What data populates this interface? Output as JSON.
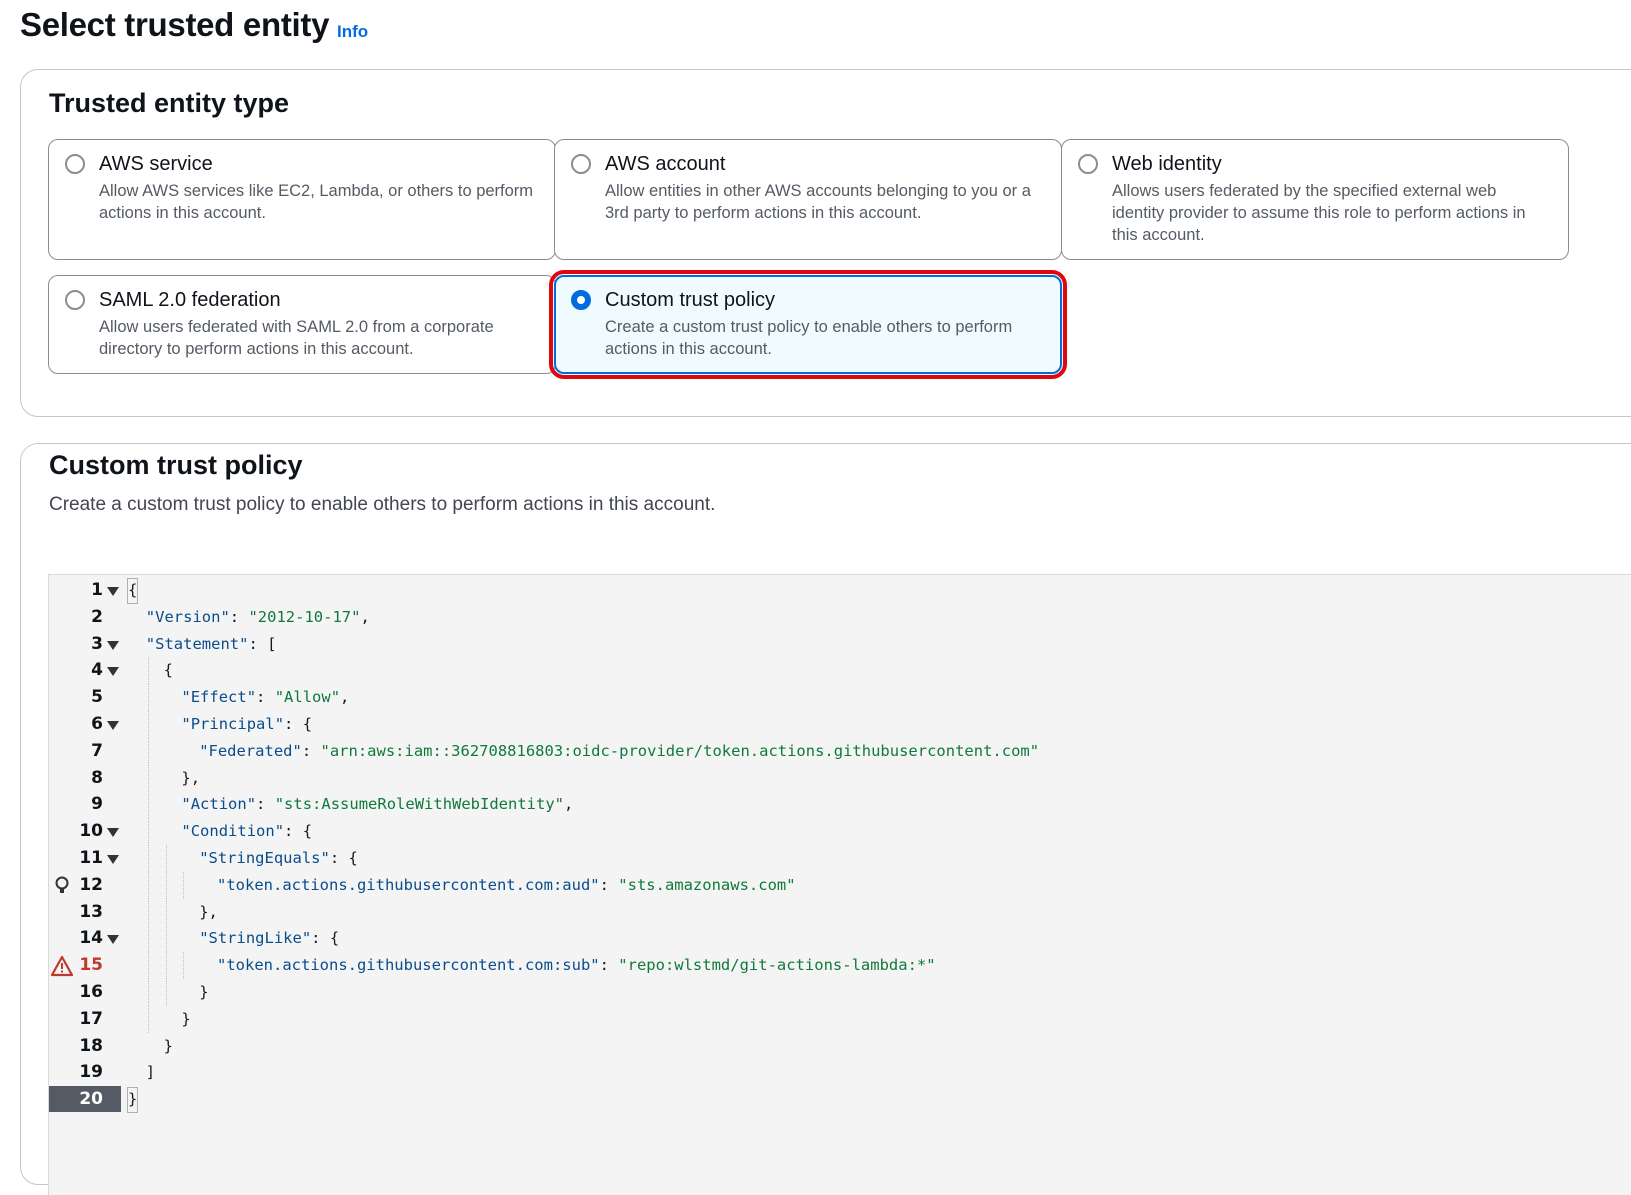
{
  "header": {
    "title": "Select trusted entity",
    "info_link": "Info"
  },
  "entity_section": {
    "heading": "Trusted entity type",
    "options": [
      {
        "title": "AWS service",
        "description": "Allow AWS services like EC2, Lambda, or others to perform actions in this account.",
        "selected": false
      },
      {
        "title": "AWS account",
        "description": "Allow entities in other AWS accounts belonging to you or a 3rd party to perform actions in this account.",
        "selected": false
      },
      {
        "title": "Web identity",
        "description": "Allows users federated by the specified external web identity provider to assume this role to perform actions in this account.",
        "selected": false
      },
      {
        "title": "SAML 2.0 federation",
        "description": "Allow users federated with SAML 2.0 from a corporate directory to perform actions in this account.",
        "selected": false
      },
      {
        "title": "Custom trust policy",
        "description": "Create a custom trust policy to enable others to perform actions in this account.",
        "selected": true
      }
    ]
  },
  "policy_section": {
    "heading": "Custom trust policy",
    "description": "Create a custom trust policy to enable others to perform actions in this account.",
    "editor": {
      "active_line": 20,
      "lines": [
        {
          "n": "1",
          "text": "{"
        },
        {
          "n": "2",
          "text": "\"Version\": \"2012-10-17\","
        },
        {
          "n": "3",
          "text": "\"Statement\": ["
        },
        {
          "n": "4",
          "text": "{"
        },
        {
          "n": "5",
          "text": "\"Effect\": \"Allow\","
        },
        {
          "n": "6",
          "text": "\"Principal\": {"
        },
        {
          "n": "7",
          "text": "\"Federated\": \"arn:aws:iam::362708816803:oidc-provider/token.actions.githubusercontent.com\""
        },
        {
          "n": "8",
          "text": "},"
        },
        {
          "n": "9",
          "text": "\"Action\": \"sts:AssumeRoleWithWebIdentity\","
        },
        {
          "n": "10",
          "text": "\"Condition\": {"
        },
        {
          "n": "11",
          "text": "\"StringEquals\": {"
        },
        {
          "n": "12",
          "text": "\"token.actions.githubusercontent.com:aud\": \"sts.amazonaws.com\""
        },
        {
          "n": "13",
          "text": "},"
        },
        {
          "n": "14",
          "text": "\"StringLike\": {"
        },
        {
          "n": "15",
          "text": "\"token.actions.githubusercontent.com:sub\": \"repo:wlstmd/git-actions-lambda:*\""
        },
        {
          "n": "16",
          "text": "}"
        },
        {
          "n": "17",
          "text": "}"
        },
        {
          "n": "18",
          "text": "}"
        },
        {
          "n": "19",
          "text": "]"
        },
        {
          "n": "20",
          "text": "}"
        }
      ],
      "gutter_markers": {
        "12": "lightbulb-icon",
        "15": "warning-icon"
      },
      "foldable_lines": [
        1,
        3,
        4,
        6,
        10,
        11,
        14
      ]
    }
  },
  "colors": {
    "accent": "#006ce0",
    "highlight_outline": "#e0060f",
    "warning": "#c0392b",
    "json_key": "#0b4c8c",
    "json_string": "#0f7a3a"
  }
}
